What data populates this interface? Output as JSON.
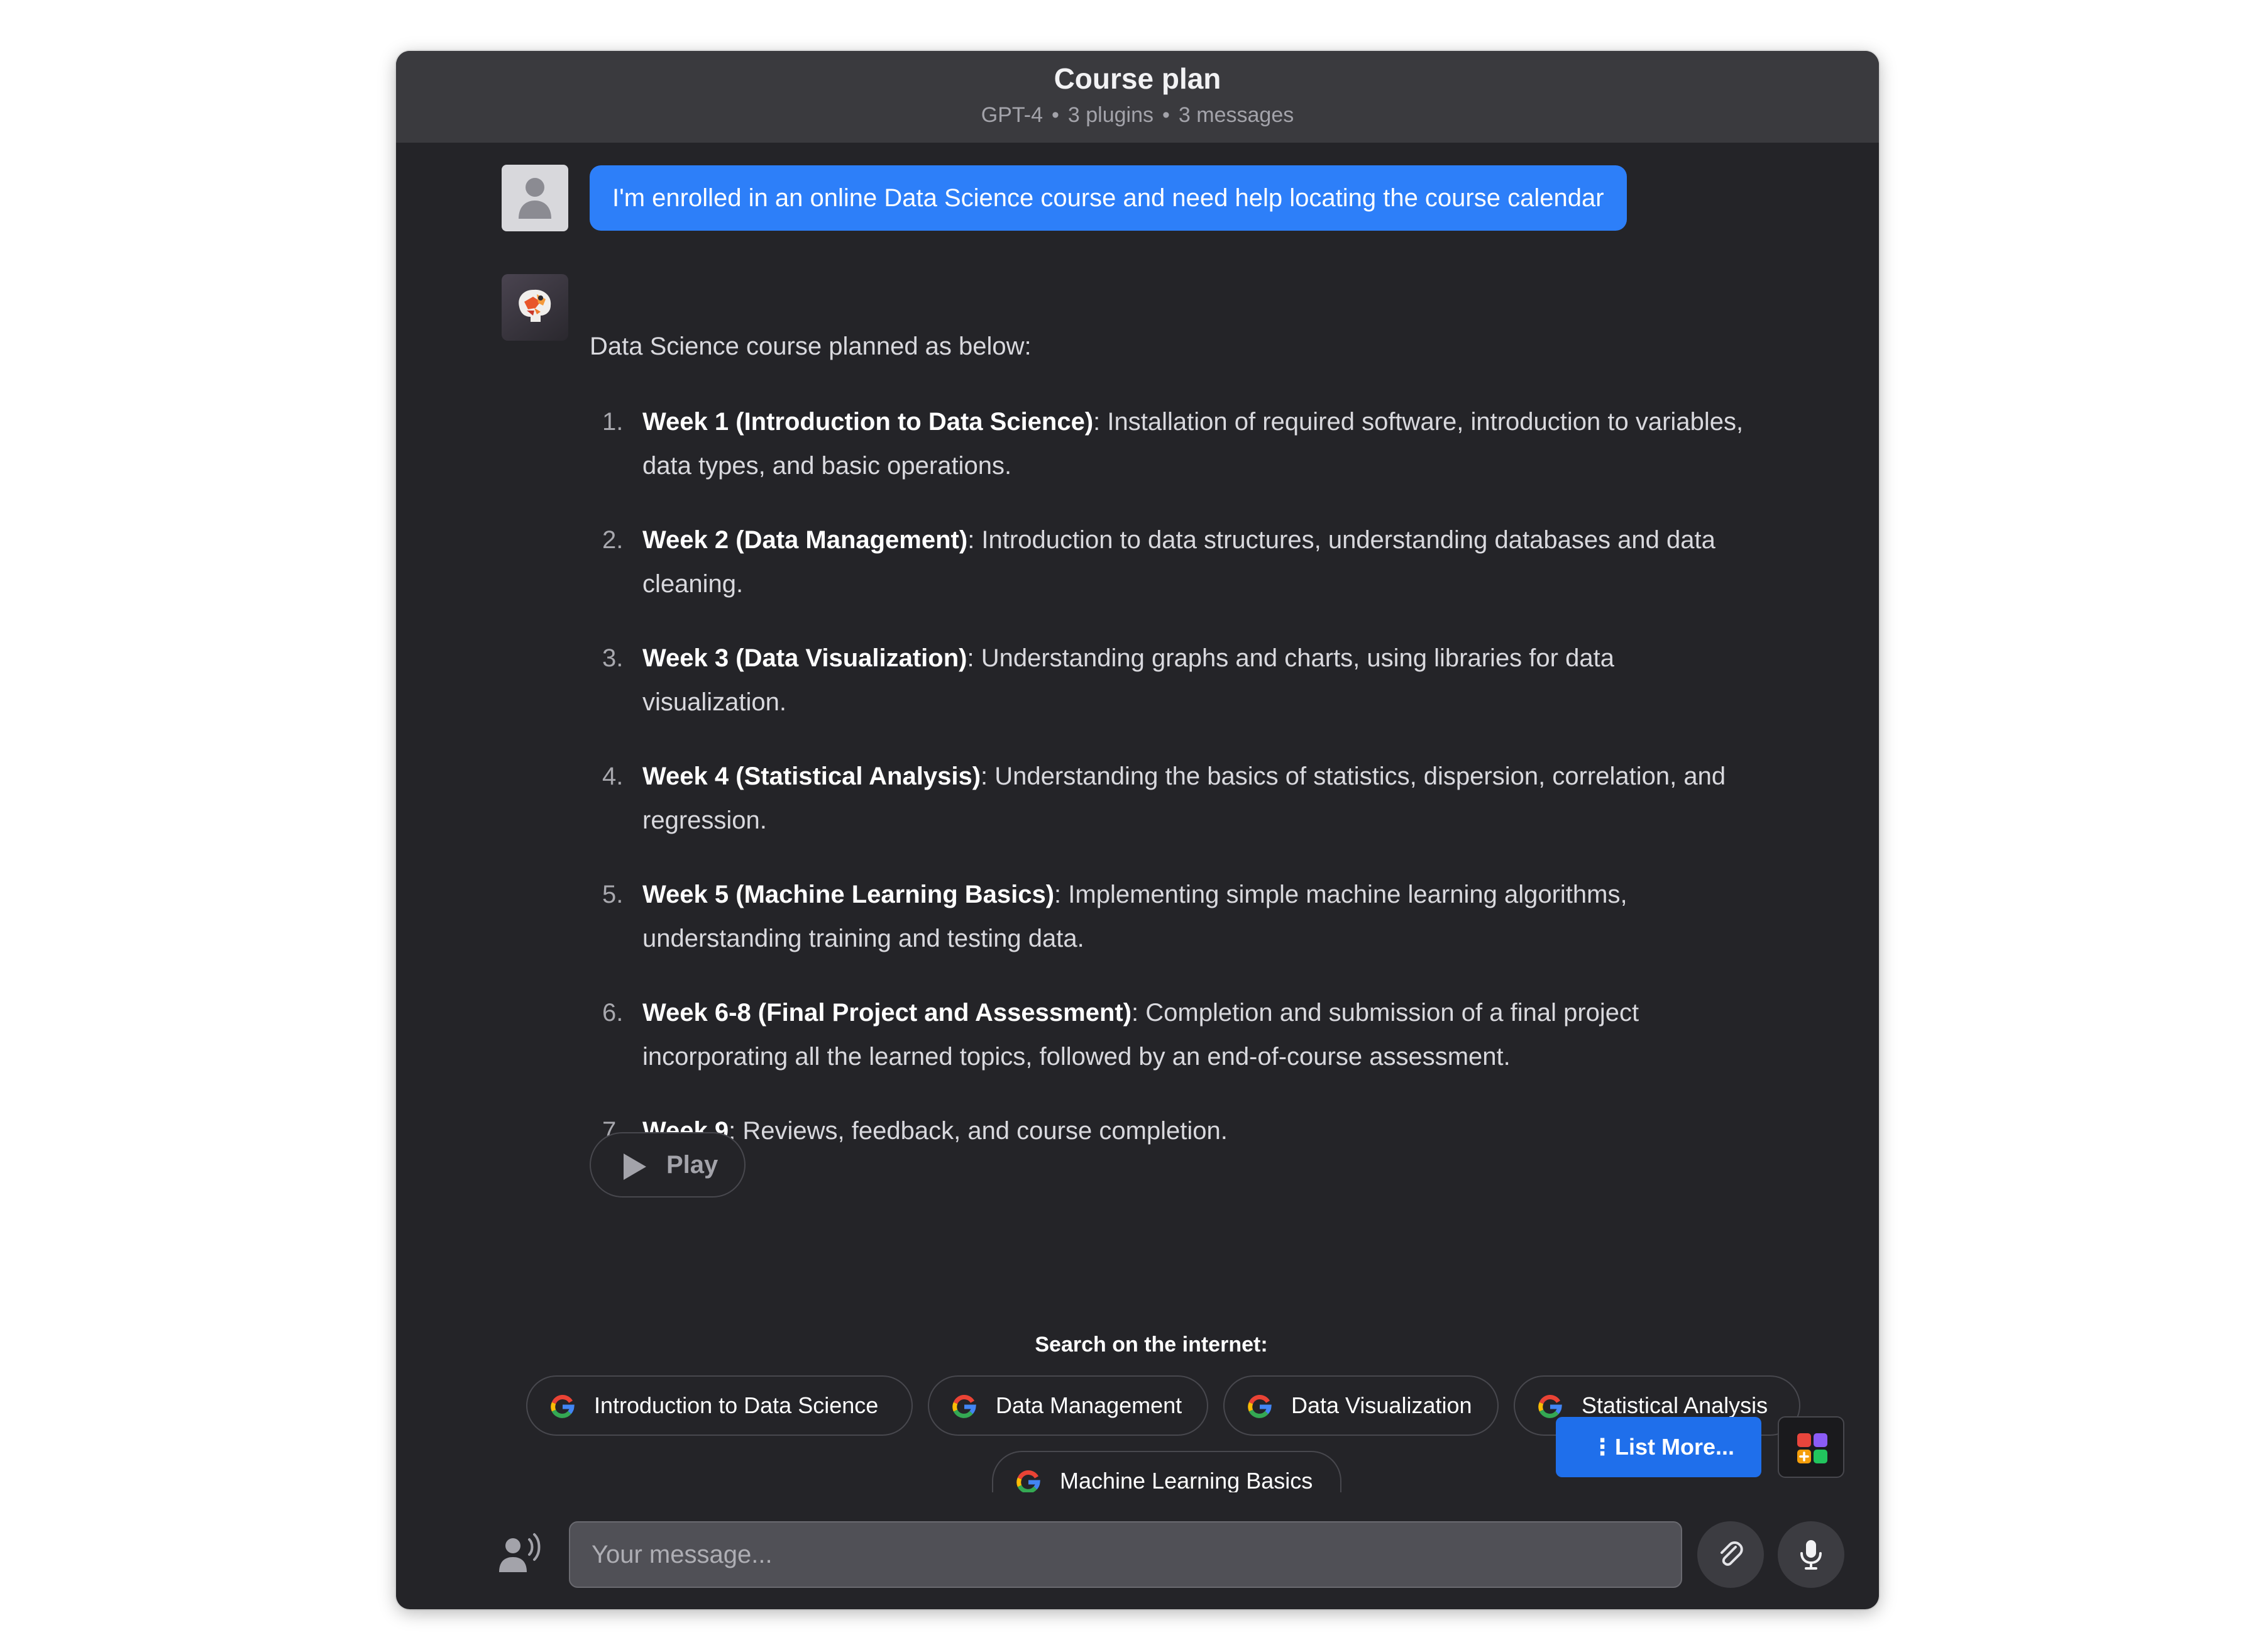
{
  "header": {
    "title": "Course plan",
    "model": "GPT-4",
    "plugins": "3 plugins",
    "messages": "3 messages",
    "separator": "•"
  },
  "user_message": "I'm enrolled in an online Data Science course and need help locating the course calendar",
  "assistant": {
    "intro": "Data Science course planned as below:",
    "items": [
      {
        "num": "1.",
        "title": "Week 1 (Introduction to Data Science)",
        "line1": ": Installation of required software, introduction to variables,",
        "line2": "data types, and basic operations."
      },
      {
        "num": "2.",
        "title": "Week 2 (Data Management)",
        "line1": ": Introduction to data structures, understanding databases and data",
        "line2": "cleaning."
      },
      {
        "num": "3.",
        "title": "Week 3 (Data Visualization)",
        "line1": ": Understanding graphs and charts, using libraries for data",
        "line2": "visualization."
      },
      {
        "num": "4.",
        "title": "Week 4 (Statistical Analysis)",
        "line1": ": Understanding the basics of statistics, dispersion, correlation, and",
        "line2": "regression."
      },
      {
        "num": "5.",
        "title": "Week 5 (Machine Learning Basics)",
        "line1": ": Implementing simple machine learning algorithms,",
        "line2": "understanding training and testing data."
      },
      {
        "num": "6.",
        "title": "Week 6-8 (Final Project and Assessment)",
        "line1": ": Completion and submission of a final project",
        "line2": "incorporating all the learned topics, followed by an end-of-course assessment."
      },
      {
        "num": "7.",
        "title": "Week 9",
        "line1": ": Reviews, feedback, and course completion.",
        "line2": ""
      }
    ],
    "play_label": "Play"
  },
  "search": {
    "title": "Search on the internet:",
    "chips": [
      "Introduction to Data Science",
      "Data Management",
      "Data Visualization",
      "Statistical Analysis",
      "Machine Learning Basics"
    ]
  },
  "list_more": {
    "dots": "⋮",
    "label": "List More..."
  },
  "composer": {
    "placeholder": "Your message..."
  },
  "icons": {
    "user_avatar": "person-icon",
    "bot_avatar": "brain-icon",
    "play": "play-icon",
    "google": "google-g-icon",
    "apps": "apps-grid-icon",
    "voice": "voice-user-icon",
    "attach": "paperclip-icon",
    "mic": "microphone-icon"
  },
  "colors": {
    "accent": "#2d7ff9",
    "list_more_bg": "#1f6feb",
    "window_bg": "#242428",
    "header_bg": "#3a3a3e"
  }
}
